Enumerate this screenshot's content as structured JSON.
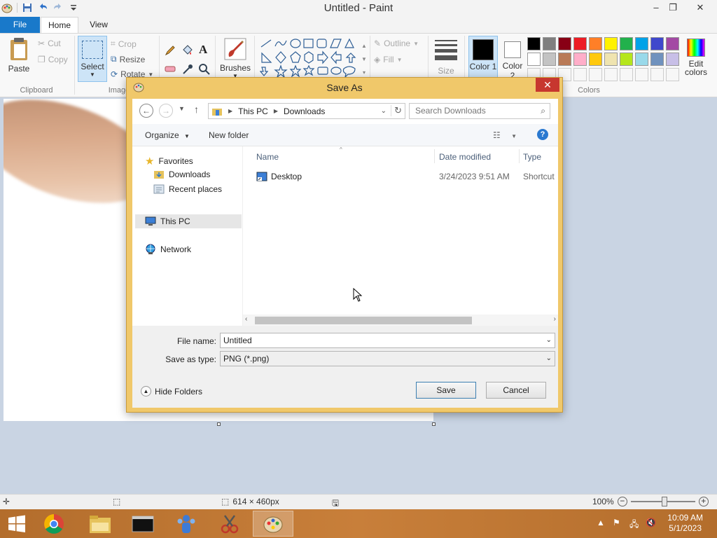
{
  "window": {
    "title": "Untitled - Paint",
    "controls": {
      "minimize": "–",
      "restore": "❐",
      "close": "✕"
    }
  },
  "tabs": {
    "file": "File",
    "home": "Home",
    "view": "View"
  },
  "ribbon": {
    "clipboard": {
      "paste": "Paste",
      "cut": "Cut",
      "copy": "Copy",
      "label": "Clipboard"
    },
    "image": {
      "select": "Select",
      "crop": "Crop",
      "resize": "Resize",
      "rotate": "Rotate",
      "label": "Image"
    },
    "brushes": "Brushes",
    "shapes": {
      "outline": "Outline",
      "fill": "Fill"
    },
    "size": "Size",
    "color1": "Color 1",
    "color2": "Color 2",
    "colors_label": "Colors",
    "edit_colors": "Edit colors",
    "palette_row1": [
      "#000000",
      "#7f7f7f",
      "#880015",
      "#ed1c24",
      "#ff7f27",
      "#fff200",
      "#22b14c",
      "#00a2e8",
      "#3f48cc",
      "#a349a4"
    ],
    "palette_row2": [
      "#ffffff",
      "#c3c3c3",
      "#b97a57",
      "#ffaec9",
      "#ffc90e",
      "#efe4b0",
      "#b5e61d",
      "#99d9ea",
      "#7092be",
      "#c8bfe7"
    ],
    "color1_value": "#000000",
    "color2_value": "#ffffff"
  },
  "status": {
    "size": "614 × 460px",
    "zoom": "100%"
  },
  "taskbar": {
    "time": "10:09 AM",
    "date": "5/1/2023"
  },
  "dialog": {
    "title": "Save As",
    "breadcrumb": [
      "This PC",
      "Downloads"
    ],
    "search_placeholder": "Search Downloads",
    "organize": "Organize",
    "new_folder": "New folder",
    "nav": {
      "favorites": "Favorites",
      "downloads": "Downloads",
      "recent": "Recent places",
      "this_pc": "This PC",
      "network": "Network"
    },
    "columns": {
      "name": "Name",
      "date": "Date modified",
      "type": "Type"
    },
    "files": [
      {
        "name": "Desktop",
        "date": "3/24/2023 9:51 AM",
        "type": "Shortcut"
      }
    ],
    "file_name_label": "File name:",
    "file_name_value": "Untitled",
    "save_type_label": "Save as type:",
    "save_type_value": "PNG (*.png)",
    "hide_folders": "Hide Folders",
    "save": "Save",
    "cancel": "Cancel"
  }
}
